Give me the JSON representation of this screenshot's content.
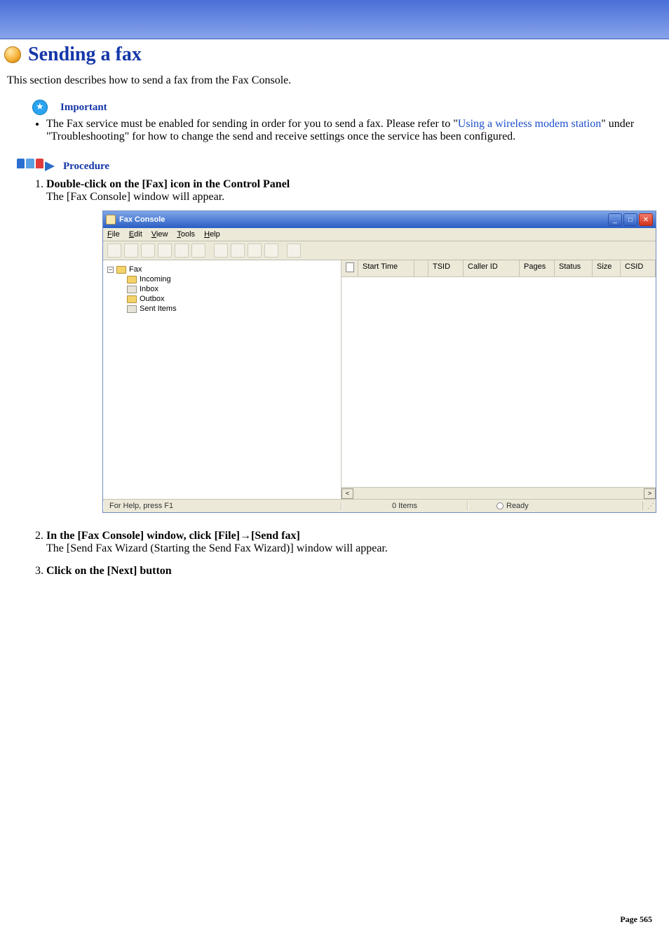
{
  "page": {
    "title": "Sending a fax",
    "intro": "This section describes how to send a fax from the Fax Console.",
    "important_label": "Important",
    "important_pre": "The Fax service must be enabled for sending in order for you to send a fax.\nPlease refer to \"",
    "important_link": "Using a wireless modem station",
    "important_post": "\" under \"Troubleshooting\" for how to change the send and receive settings once the service has been configured.",
    "procedure_label": "Procedure",
    "steps": [
      {
        "title": "Double-click on the [Fax] icon in the Control Panel",
        "desc": "The [Fax Console] window will appear."
      },
      {
        "title": "In the [Fax Console] window, click [File]→[Send fax]",
        "desc": "The [Send Fax Wizard (Starting the Send Fax Wizard)] window will appear."
      },
      {
        "title": "Click on the [Next] button",
        "desc": ""
      }
    ],
    "footer": "Page 565"
  },
  "screenshot": {
    "window_title": "Fax Console",
    "menus": {
      "file": "File",
      "edit": "Edit",
      "view": "View",
      "tools": "Tools",
      "help": "Help"
    },
    "tree": {
      "root": "Fax",
      "incoming": "Incoming",
      "inbox": "Inbox",
      "outbox": "Outbox",
      "sent": "Sent Items"
    },
    "columns": {
      "doc": "",
      "start": "Start Time",
      "sort": "",
      "tsid": "TSID",
      "caller": "Caller ID",
      "pages": "Pages",
      "status": "Status",
      "size": "Size",
      "csid": "CSID"
    },
    "status": {
      "help": "For Help, press F1",
      "items": "0 Items",
      "ready": "Ready"
    }
  }
}
